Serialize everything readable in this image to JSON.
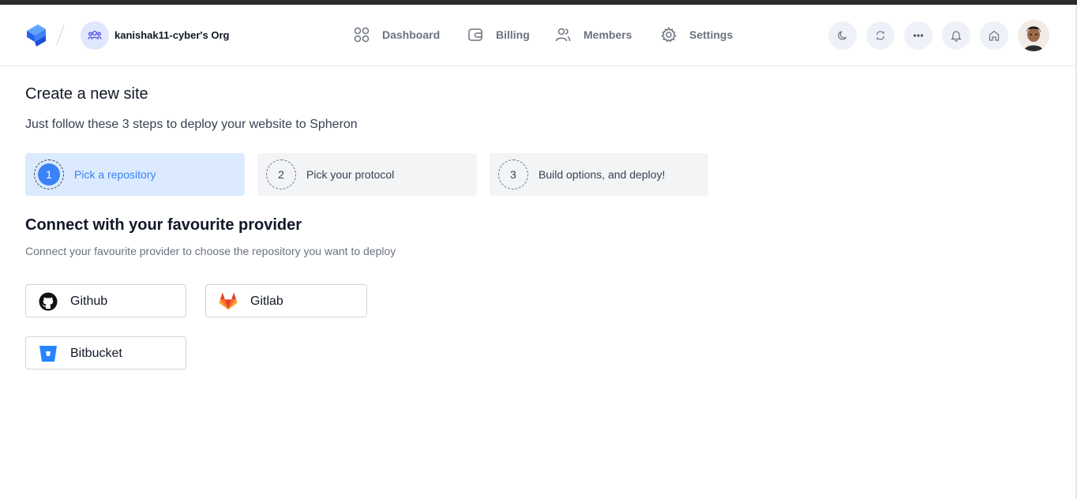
{
  "org": {
    "name": "kanishak11-cyber's Org"
  },
  "nav": {
    "dashboard": "Dashboard",
    "billing": "Billing",
    "members": "Members",
    "settings": "Settings"
  },
  "header_icons": [
    "moon-icon",
    "refresh-icon",
    "more-dots-icon",
    "bell-icon",
    "home-icon"
  ],
  "page": {
    "title": "Create a new site",
    "subtitle": "Just follow these 3 steps to deploy your website to Spheron"
  },
  "steps": [
    {
      "number": "1",
      "label": "Pick a repository",
      "active": true
    },
    {
      "number": "2",
      "label": "Pick your protocol",
      "active": false
    },
    {
      "number": "3",
      "label": "Build options, and deploy!",
      "active": false
    }
  ],
  "providers_section": {
    "title": "Connect with your favourite provider",
    "subtitle": "Connect your favourite provider to choose the repository you want to deploy"
  },
  "providers": [
    {
      "label": "Github",
      "icon": "github-icon"
    },
    {
      "label": "Gitlab",
      "icon": "gitlab-icon"
    },
    {
      "label": "Bitbucket",
      "icon": "bitbucket-icon"
    }
  ],
  "colors": {
    "accent": "#3b82f6",
    "active_step_bg": "#dbeafe",
    "step_bg": "#f3f4f6",
    "icon_circle_bg": "#eef1f8"
  }
}
